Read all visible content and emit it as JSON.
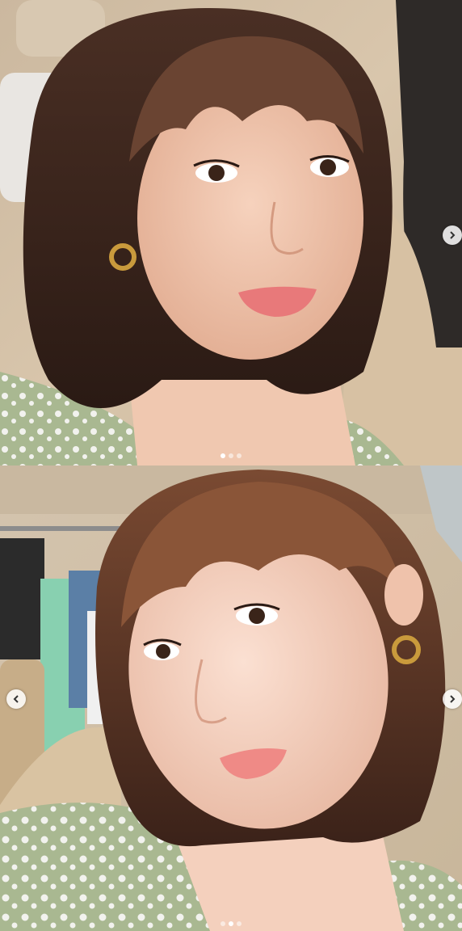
{
  "posts": [
    {
      "image": "selfie-photo-1",
      "has_prev": false,
      "has_next": true,
      "slide_count": 3,
      "active_slide": 1
    },
    {
      "image": "selfie-photo-2",
      "has_prev": true,
      "has_next": true,
      "slide_count": 3,
      "active_slide": 2
    }
  ],
  "icons": {
    "prev": "chevron-left-icon",
    "next": "chevron-right-icon"
  },
  "colors": {
    "nav_bg": "#ffffff",
    "dot_active": "#ffffff",
    "dot_inactive": "#c8c8c8"
  }
}
